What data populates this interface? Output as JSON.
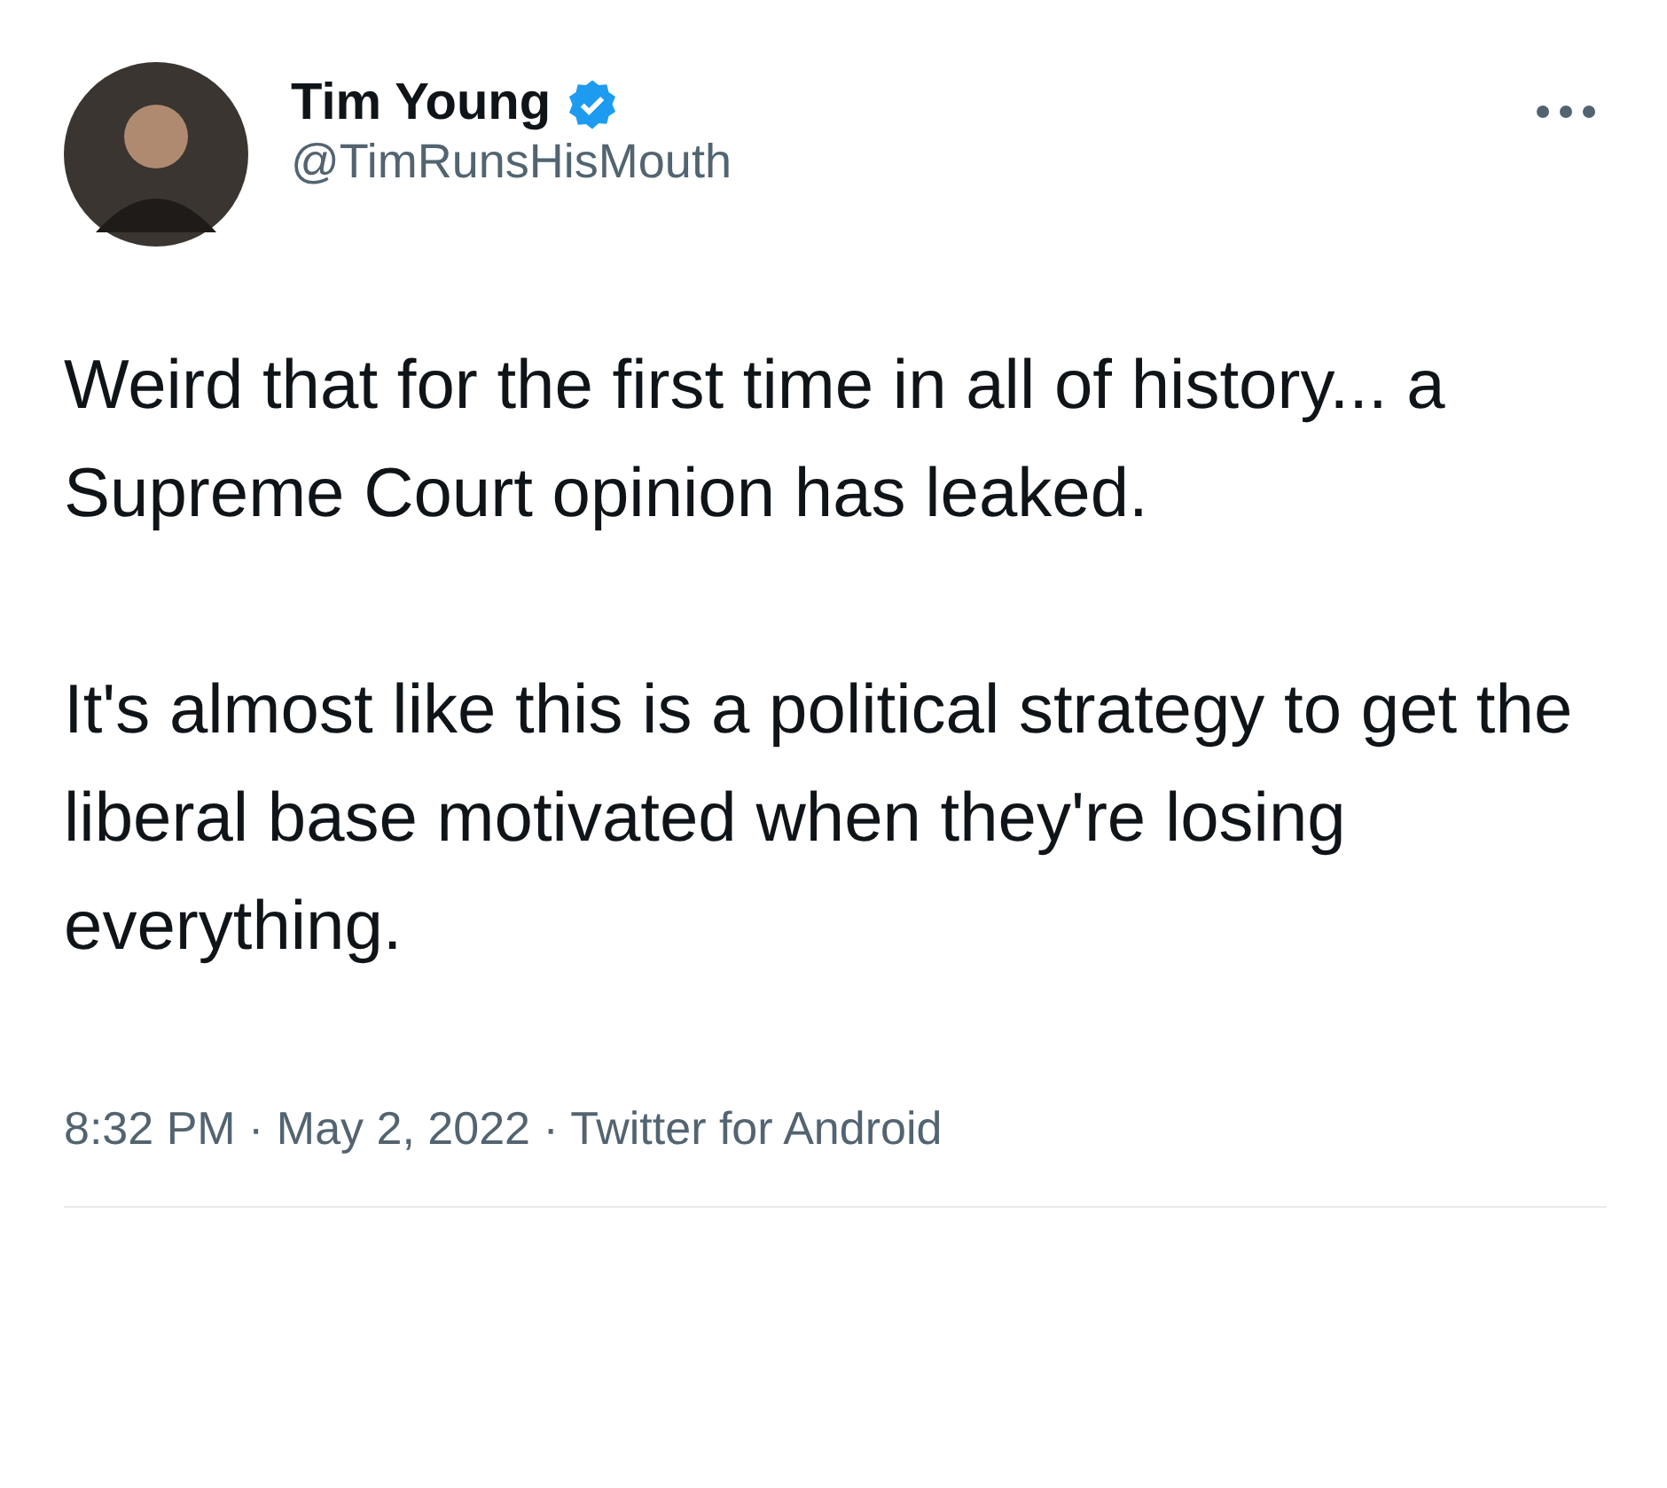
{
  "author": {
    "name": "Tim Young",
    "verified": true,
    "handle": "@TimRunsHisMouth"
  },
  "paragraphs": [
    "Weird that for the first time in all of history... a Supreme Court opinion has leaked.",
    "It's almost like this is a political strategy to get the liberal base motivated when they're losing everything."
  ],
  "meta": "8:32 PM · May 2, 2022 · Twitter for Android"
}
